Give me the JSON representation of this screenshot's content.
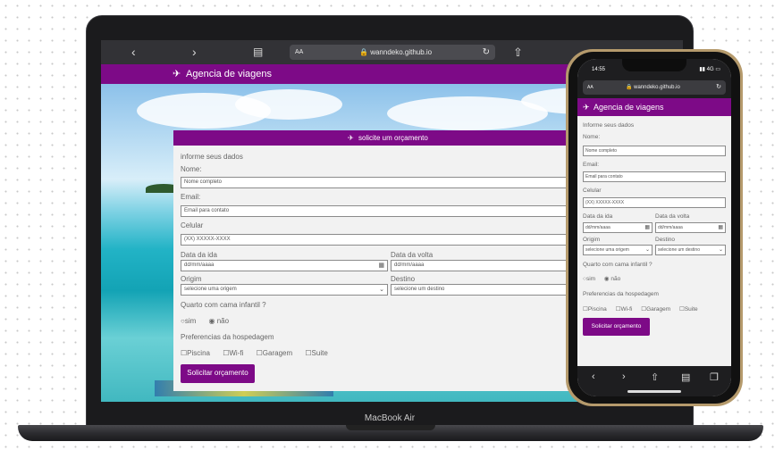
{
  "laptop": {
    "model": "MacBook Air",
    "browser": {
      "text_size_label": "AA",
      "url": "wanndeko.github.io",
      "back_icon": "chevron-left-icon",
      "forward_icon": "chevron-right-icon",
      "bookmarks_icon": "book-icon",
      "reload_icon": "reload-icon",
      "share_icon": "share-icon"
    },
    "site": {
      "title": "Agencia de viagens",
      "form": {
        "heading": "solicite um orçamento",
        "section_label": "informe seus dados",
        "name_label": "Nome:",
        "name_placeholder": "Nome completo",
        "email_label": "Email:",
        "email_placeholder": "Email para contato",
        "phone_label": "Celular",
        "phone_placeholder": "(XX) XXXXX-XXXX",
        "departure_label": "Data da ida",
        "departure_value": "dd/mm/aaaa",
        "return_label": "Data da volta",
        "return_value": "dd/mm/aaaa",
        "origin_label": "Origim",
        "origin_value": "selecione uma origem",
        "destination_label": "Destino",
        "destination_value": "selecione um destino",
        "crib_question": "Quarto com cama infantil ?",
        "crib_options": [
          "sim",
          "não"
        ],
        "crib_selected": "não",
        "prefs_label": "Preferencias da hospedagem",
        "prefs_options": [
          "Piscina",
          "Wi-fi",
          "Garagem",
          "Suite"
        ],
        "submit_label": "Solicitar orçamento"
      }
    }
  },
  "phone": {
    "status": {
      "time": "14:55",
      "signal": "4G"
    },
    "browser": {
      "text_size_label": "AA",
      "url": "wanndeko.github.io"
    },
    "site": {
      "title": "Agencia de viagens",
      "form": {
        "section_label": "Informe seus dados",
        "name_label": "Nome:",
        "name_placeholder": "Nome completo",
        "email_label": "Email:",
        "email_placeholder": "Email para contato",
        "phone_label": "Celular",
        "phone_placeholder": "(XX) XXXXX-XXXX",
        "departure_label": "Data da ida",
        "departure_value": "dd/mm/aaaa",
        "return_label": "Data da volta",
        "return_value": "dd/mm/aaaa",
        "origin_label": "Origim",
        "origin_value": "selecione uma origem",
        "destination_label": "Destino",
        "destination_value": "selecione um destino",
        "crib_question": "Quarto com cama infantil ?",
        "crib_options": [
          "sim",
          "não"
        ],
        "crib_selected": "não",
        "prefs_label": "Preferencias da hospedagem",
        "prefs_options": [
          "Piscina",
          "Wi-fi",
          "Garagem",
          "Suite"
        ],
        "submit_label": "Solicitar orçamento"
      }
    },
    "toolbar": [
      "chevron-left-icon",
      "chevron-right-icon",
      "share-icon",
      "book-icon",
      "tabs-icon"
    ]
  },
  "colors": {
    "brand_purple": "#7d0a87",
    "form_background": "#f2f2f2",
    "phone_frame": "#b59a6c"
  }
}
